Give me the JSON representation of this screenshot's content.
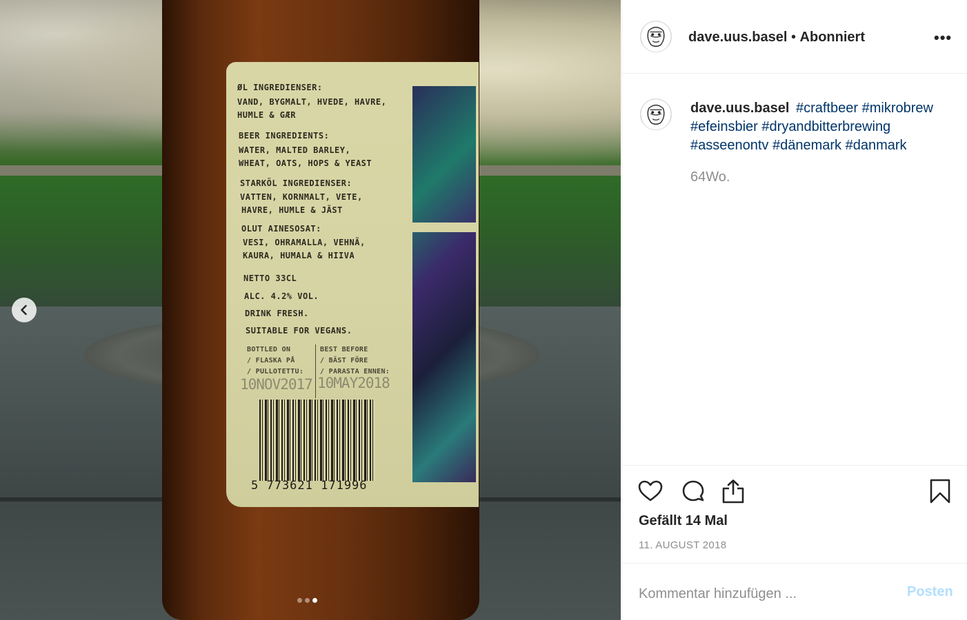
{
  "header": {
    "username": "dave.uus.basel",
    "separator": "•",
    "follow_status": "Abonniert",
    "more_label": "•••"
  },
  "caption": {
    "username": "dave.uus.basel",
    "hashtags": [
      "#craftbeer",
      "#mikrobrew",
      "#efeinsbier",
      "#dryandbitterbrewing",
      "#asseenontv",
      "#dänemark",
      "#danmark"
    ],
    "age": "64Wo."
  },
  "actions": {
    "icons": [
      "heart-icon",
      "comment-icon",
      "share-icon",
      "bookmark-icon"
    ],
    "likes": "Gefällt 14 Mal",
    "date": "11. AUGUST 2018"
  },
  "comment": {
    "placeholder": "Kommentar hinzufügen ...",
    "post_label": "Posten"
  },
  "carousel": {
    "prev_icon": "chevron-left-icon",
    "slide_count": 3,
    "active_slide": 3
  },
  "photo": {
    "label_lines": [
      "ØL INGREDIENSER:",
      "VAND, BYGMALT, HVEDE, HAVRE,",
      "HUMLE & GÆR",
      "BEER INGREDIENTS:",
      "WATER, MALTED BARLEY,",
      "WHEAT, OATS, HOPS & YEAST",
      "STARKÖL INGREDIENSER:",
      "VATTEN, KORNMALT, VETE,",
      "HAVRE, HUMLE & JÄST",
      "OLUT AINESOSAT:",
      "VESI, OHRAMALLA, VEHNÄ,",
      "KAURA, HUMALA & HIIVA",
      "NETTO 33CL",
      "ALC. 4.2% VOL.",
      "DRINK FRESH.",
      "SUITABLE FOR VEGANS."
    ],
    "bottled_label": "BOTTLED ON\n/ FLASKA PÅ\n/ PULLOTETTU:",
    "best_before_label": "BEST BEFORE\n/ BÄST FÖRE\n/ PARASTA ENNEN:",
    "bottled_date": "10NOV2017",
    "best_before_date": "10MAY2018",
    "barcode": "5 773621 171996"
  }
}
